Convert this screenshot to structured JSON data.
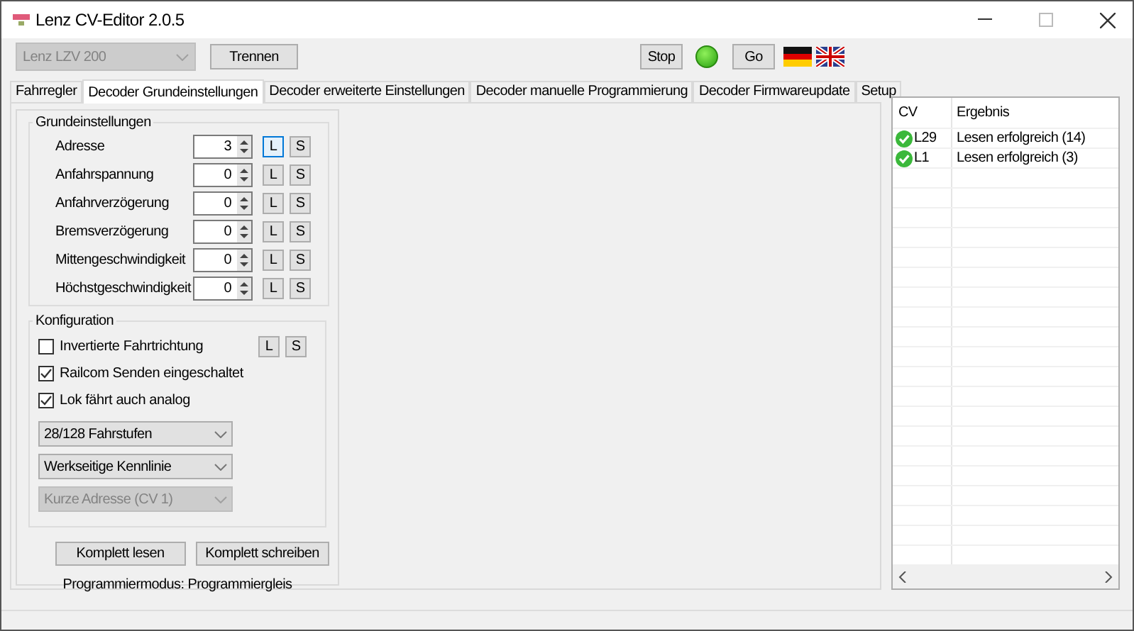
{
  "window": {
    "title": "Lenz CV-Editor 2.0.5"
  },
  "toolbar": {
    "interface_select": {
      "value": "Lenz LZV 200",
      "disabled": true
    },
    "disconnect_button": "Trennen",
    "stop_button": "Stop",
    "status_led": {
      "on": true
    },
    "go_button": "Go"
  },
  "tabs": [
    {
      "label": "Fahrregler",
      "selected": false
    },
    {
      "label": "Decoder Grundeinstellungen",
      "selected": true
    },
    {
      "label": "Decoder erweiterte Einstellungen",
      "selected": false
    },
    {
      "label": "Decoder manuelle Programmierung",
      "selected": false
    },
    {
      "label": "Decoder Firmwareupdate",
      "selected": false
    },
    {
      "label": "Setup",
      "selected": false
    }
  ],
  "basic_settings": {
    "title": "Grundeinstellungen",
    "rows": [
      {
        "label": "Adresse",
        "value": "3",
        "read_button": "L",
        "write_button": "S",
        "focused": true
      },
      {
        "label": "Anfahrspannung",
        "value": "0",
        "read_button": "L",
        "write_button": "S",
        "focused": false
      },
      {
        "label": "Anfahrverzögerung",
        "value": "0",
        "read_button": "L",
        "write_button": "S",
        "focused": false
      },
      {
        "label": "Bremsverzögerung",
        "value": "0",
        "read_button": "L",
        "write_button": "S",
        "focused": false
      },
      {
        "label": "Mittengeschwindigkeit",
        "value": "0",
        "read_button": "L",
        "write_button": "S",
        "focused": false
      },
      {
        "label": "Höchstgeschwindigkeit",
        "value": "0",
        "read_button": "L",
        "write_button": "S",
        "focused": false
      }
    ]
  },
  "configuration": {
    "title": "Konfiguration",
    "items": [
      {
        "kind": "checkbox",
        "label": "Invertierte Fahrtrichtung",
        "checked": false,
        "read_button": "L",
        "write_button": "S"
      },
      {
        "kind": "checkbox",
        "label": "Railcom Senden eingeschaltet",
        "checked": true
      },
      {
        "kind": "checkbox",
        "label": "Lok fährt auch analog",
        "checked": true
      },
      {
        "kind": "select",
        "value": "28/128 Fahrstufen",
        "disabled": false
      },
      {
        "kind": "select",
        "value": "Werkseitige Kennlinie",
        "disabled": false
      },
      {
        "kind": "select",
        "value": "Kurze Adresse (CV 1)",
        "disabled": true
      }
    ]
  },
  "actions": [
    "Komplett lesen",
    "Komplett schreiben"
  ],
  "mode_text": "Programmiermodus: Programmiergleis",
  "results": {
    "columns": [
      "CV",
      "Ergebnis"
    ],
    "rows": [
      {
        "cv": "L29",
        "result": "Lesen erfolgreich (14)"
      },
      {
        "cv": "L1",
        "result": "Lesen erfolgreich (3)"
      }
    ]
  }
}
